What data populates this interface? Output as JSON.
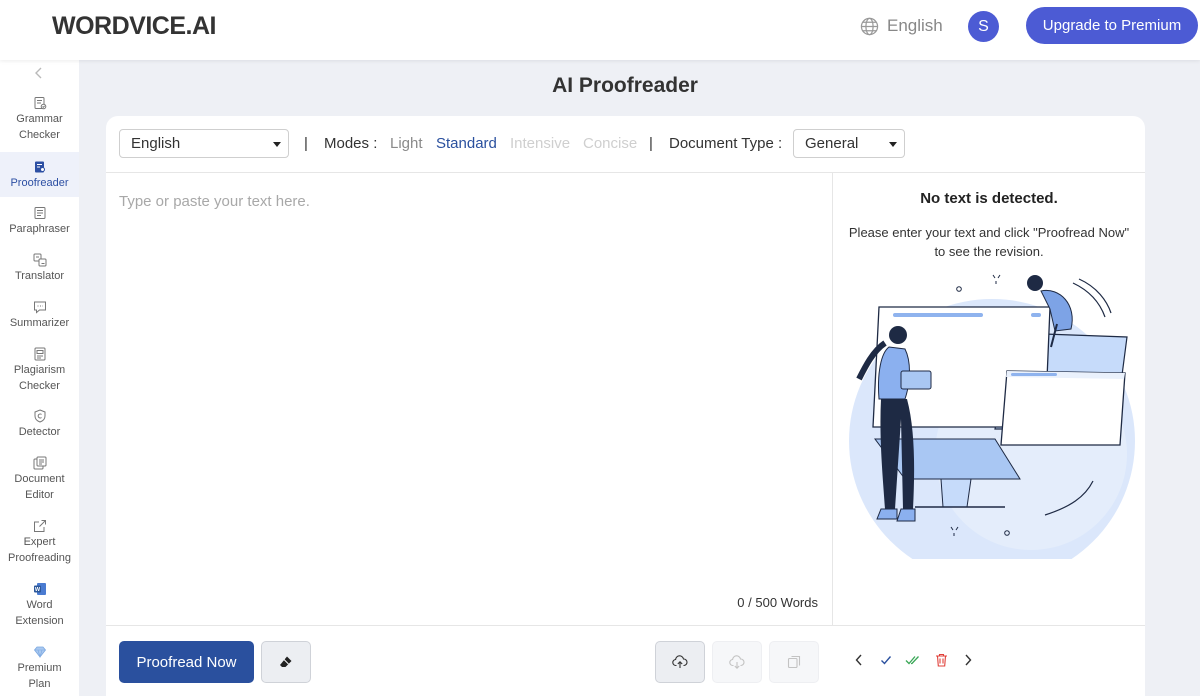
{
  "header": {
    "logo": "WORDVICE.AI",
    "language": "English",
    "avatar_initial": "S",
    "upgrade_label": "Upgrade to Premium"
  },
  "sidebar": {
    "items": [
      {
        "label": "Grammar\nChecker",
        "icon": "grammar-icon"
      },
      {
        "label": "Proofreader",
        "icon": "proofreader-icon",
        "active": true
      },
      {
        "label": "Paraphraser",
        "icon": "paraphraser-icon"
      },
      {
        "label": "Translator",
        "icon": "translator-icon"
      },
      {
        "label": "Summarizer",
        "icon": "summarizer-icon"
      },
      {
        "label": "Plagiarism\nChecker",
        "icon": "plagiarism-icon"
      },
      {
        "label": "Detector",
        "icon": "detector-icon"
      },
      {
        "label": "Document\nEditor",
        "icon": "document-icon"
      },
      {
        "label": "Expert\nProofreading",
        "icon": "external-link-icon"
      },
      {
        "label": "Word\nExtension",
        "icon": "word-icon"
      },
      {
        "label": "Premium\nPlan",
        "icon": "diamond-icon"
      }
    ]
  },
  "page": {
    "title": "AI Proofreader"
  },
  "toolbar": {
    "language_value": "English",
    "separator": "|",
    "modes_label": "Modes :",
    "modes": [
      "Light",
      "Standard",
      "Intensive",
      "Concise"
    ],
    "selected_mode": "Standard",
    "doc_type_label": "Document Type :",
    "doc_type_value": "General"
  },
  "editor": {
    "placeholder": "Type or paste your text here.",
    "word_count": "0 / 500 Words"
  },
  "result": {
    "title": "No text is detected.",
    "message": "Please enter your text and click \"Proofread Now\" to see the revision."
  },
  "actions": {
    "proofread_label": "Proofread Now"
  },
  "colors": {
    "brand": "#4c5bd4",
    "primary_button": "#2a509e",
    "mode_selected": "#2a509e",
    "mode_enabled": "#8a8a8a",
    "mode_disabled": "#cfcfcf"
  }
}
